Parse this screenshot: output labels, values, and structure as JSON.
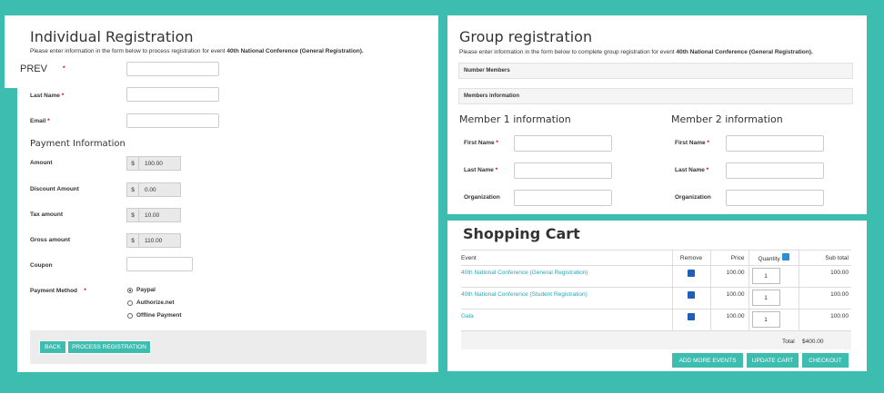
{
  "individual": {
    "title": "Individual Registration",
    "intro_pre": "Please enter information in the form below to process registration for event ",
    "intro_event": "40th National Conference (General Registration).",
    "prev_label": "PREV",
    "last_name_label": "Last Name",
    "email_label": "Email",
    "payment_heading": "Payment Information",
    "fields": [
      {
        "label": "Amount",
        "currency": "$",
        "value": "100.00"
      },
      {
        "label": "Discount Amount",
        "currency": "$",
        "value": "0.00"
      },
      {
        "label": "Tax amount",
        "currency": "$",
        "value": "10.00"
      },
      {
        "label": "Gross amount",
        "currency": "$",
        "value": "110.00"
      }
    ],
    "coupon_label": "Coupon",
    "payment_method_label": "Payment Method",
    "methods": [
      {
        "label": "Paypal",
        "checked": true
      },
      {
        "label": "Authorize.net",
        "checked": false
      },
      {
        "label": "Offline Payment",
        "checked": false
      }
    ],
    "required_mark": "*",
    "back_button": "BACK",
    "process_button": "PROCESS REGISTRATION"
  },
  "group": {
    "title": "Group registration",
    "intro_pre": "Please enter information in the form below to complete group registration for event ",
    "intro_event": "40th National Conference (General Registration).",
    "number_members": "Number Members",
    "members_information": "Members information",
    "member1_heading": "Member 1 information",
    "member2_heading": "Member 2 information",
    "first_name": "First Name",
    "last_name": "Last Name",
    "organization": "Organization"
  },
  "cart": {
    "title": "Shopping Cart",
    "columns": [
      "Event",
      "Remove",
      "Price",
      "Quantity",
      "Sub total"
    ],
    "rows": [
      {
        "event": "40th National Conference (General Registration)",
        "price": "100.00",
        "quantity": "1",
        "subtotal": "100.00"
      },
      {
        "event": "40th National Conference (Student Registration)",
        "price": "100.00",
        "quantity": "1",
        "subtotal": "100.00"
      },
      {
        "event": "Gala",
        "price": "100.00",
        "quantity": "1",
        "subtotal": "100.00"
      }
    ],
    "total_label": "Total",
    "total_value": "$400.00",
    "add_more": "ADD MORE EVENTS",
    "update": "UPDATE CART",
    "checkout": "CHECKOUT"
  }
}
